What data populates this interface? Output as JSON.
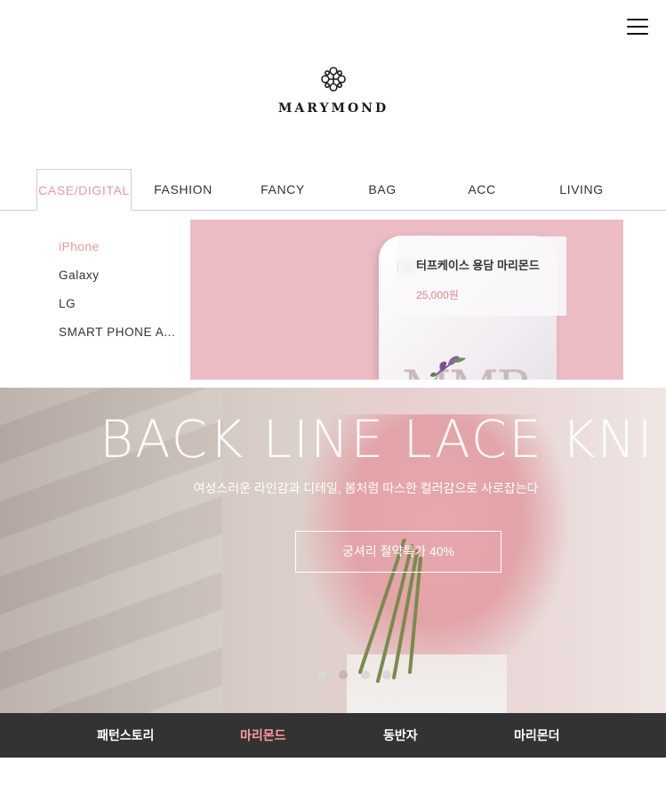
{
  "header": {
    "menu_icon": "hamburger-menu-icon",
    "logo_text": "MARYMOND",
    "logo_icon": "flower-emblem-icon"
  },
  "nav": {
    "categories": [
      {
        "label": "CASE/DIGITAL",
        "active": true
      },
      {
        "label": "FASHION",
        "active": false
      },
      {
        "label": "FANCY",
        "active": false
      },
      {
        "label": "BAG",
        "active": false
      },
      {
        "label": "ACC",
        "active": false
      },
      {
        "label": "LIVING",
        "active": false
      }
    ],
    "active_color": "#e89a9d"
  },
  "submenu": {
    "items": [
      {
        "label": "iPhone",
        "active": true
      },
      {
        "label": "Galaxy",
        "active": false
      },
      {
        "label": "LG",
        "active": false
      },
      {
        "label": "SMART PHONE A...",
        "active": false
      }
    ]
  },
  "promo": {
    "product_title": "터프케이스 용담 마리몬드",
    "price": "25,000원",
    "background_color": "#ebbcc4",
    "case_print_text": "MMP"
  },
  "hero": {
    "title": "BACK LINE LACE KNI",
    "subtitle": "여성스러운 라인감과 디테일, 봄처럼 따스한 컬러감으로 사로잡는다",
    "cta_label": "궁셔리 절약특가 40%",
    "slide_count": 4,
    "active_slide": 2
  },
  "footer_nav": {
    "items": [
      {
        "label": "패턴스토리",
        "active": false
      },
      {
        "label": "마리몬드",
        "active": true
      },
      {
        "label": "동반자",
        "active": false
      },
      {
        "label": "마리몬더",
        "active": false
      }
    ],
    "background_color": "#333333",
    "active_color": "#ff9ea1"
  }
}
